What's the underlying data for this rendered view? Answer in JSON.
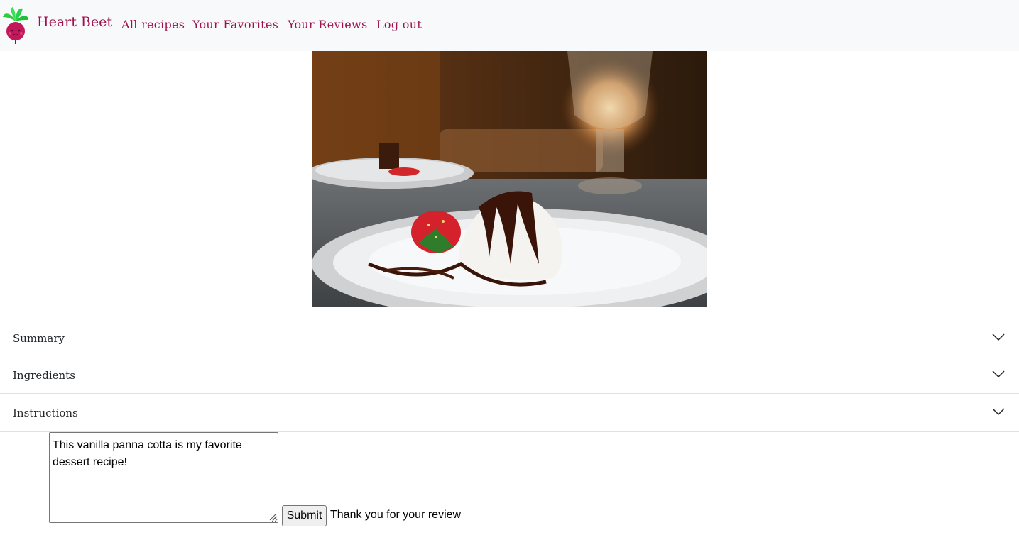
{
  "navbar": {
    "brand": "Heart Beet",
    "links": [
      "All recipes",
      "Your Favorites",
      "Your Reviews",
      "Log out"
    ],
    "brand_color": "#a0104f",
    "background": "#f8f9fa"
  },
  "hero_image": {
    "icon": "dessert-photo",
    "description_alt": "Vanilla panna cotta with chocolate drizzle and strawberry"
  },
  "accordion": {
    "items": [
      "Summary",
      "Ingredients",
      "Instructions"
    ],
    "icon": "chevron-down-icon"
  },
  "review": {
    "text": "This vanilla panna cotta is my favorite dessert recipe!",
    "submit_label": "Submit",
    "status": "Thank you for your review"
  }
}
